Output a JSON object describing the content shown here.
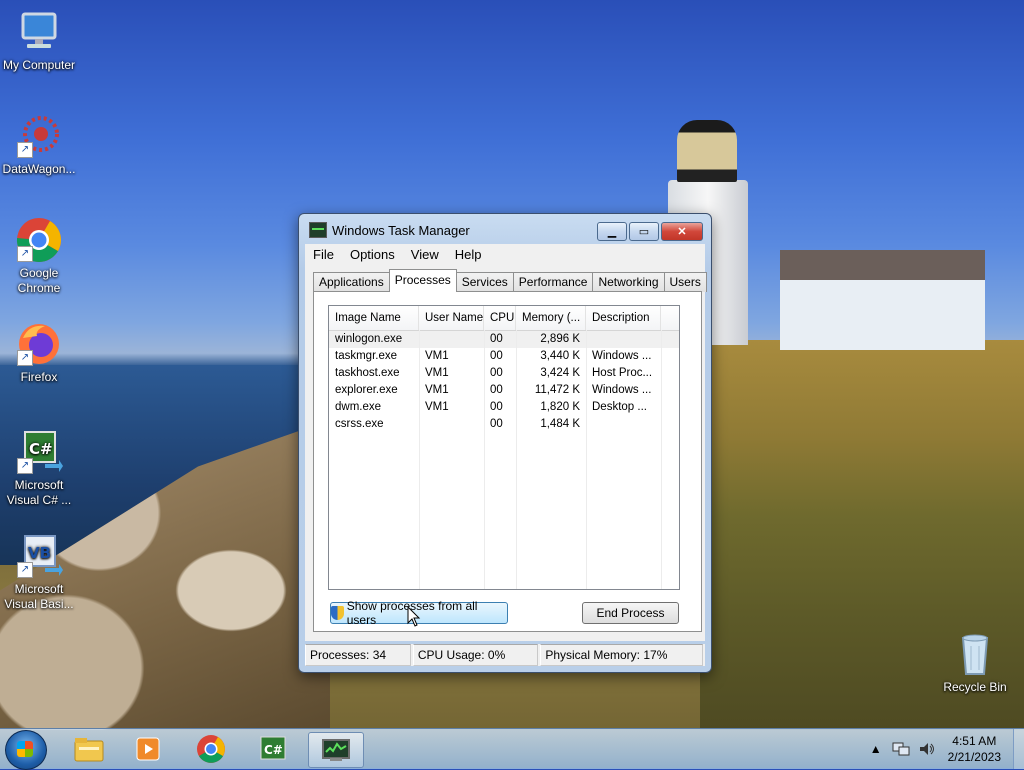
{
  "desktop": {
    "icons": [
      {
        "label": "My Computer"
      },
      {
        "label": "DataWagon..."
      },
      {
        "label": "Google Chrome"
      },
      {
        "label": "Firefox"
      },
      {
        "label": "Microsoft Visual C# ..."
      },
      {
        "label": "Microsoft Visual Basi..."
      },
      {
        "label": "Recycle Bin"
      }
    ]
  },
  "window": {
    "title": "Windows Task Manager",
    "menu": [
      "File",
      "Options",
      "View",
      "Help"
    ],
    "tabs": [
      "Applications",
      "Processes",
      "Services",
      "Performance",
      "Networking",
      "Users"
    ],
    "active_tab": "Processes",
    "columns": [
      "Image Name",
      "User Name",
      "CPU",
      "Memory (...",
      "Description"
    ],
    "rows": [
      {
        "image": "winlogon.exe",
        "user": "",
        "cpu": "00",
        "memory": "2,896 K",
        "desc": ""
      },
      {
        "image": "taskmgr.exe",
        "user": "VM1",
        "cpu": "00",
        "memory": "3,440 K",
        "desc": "Windows ..."
      },
      {
        "image": "taskhost.exe",
        "user": "VM1",
        "cpu": "00",
        "memory": "3,424 K",
        "desc": "Host Proc..."
      },
      {
        "image": "explorer.exe",
        "user": "VM1",
        "cpu": "00",
        "memory": "11,472 K",
        "desc": "Windows ..."
      },
      {
        "image": "dwm.exe",
        "user": "VM1",
        "cpu": "00",
        "memory": "1,820 K",
        "desc": "Desktop ..."
      },
      {
        "image": "csrss.exe",
        "user": "",
        "cpu": "00",
        "memory": "1,484 K",
        "desc": ""
      }
    ],
    "show_all_button": "Show processes from all users",
    "end_process_button": "End Process",
    "status": {
      "processes": "Processes: 34",
      "cpu": "CPU Usage: 0%",
      "memory": "Physical Memory: 17%"
    }
  },
  "taskbar": {
    "time": "4:51 AM",
    "date": "2/21/2023",
    "pinned": [
      "start-icon",
      "explorer-icon",
      "media-player-icon",
      "chrome-icon",
      "visual-csharp-icon",
      "task-manager-icon"
    ]
  },
  "colors": {
    "accent": "#3c7fb1",
    "close_button": "#c23628"
  }
}
